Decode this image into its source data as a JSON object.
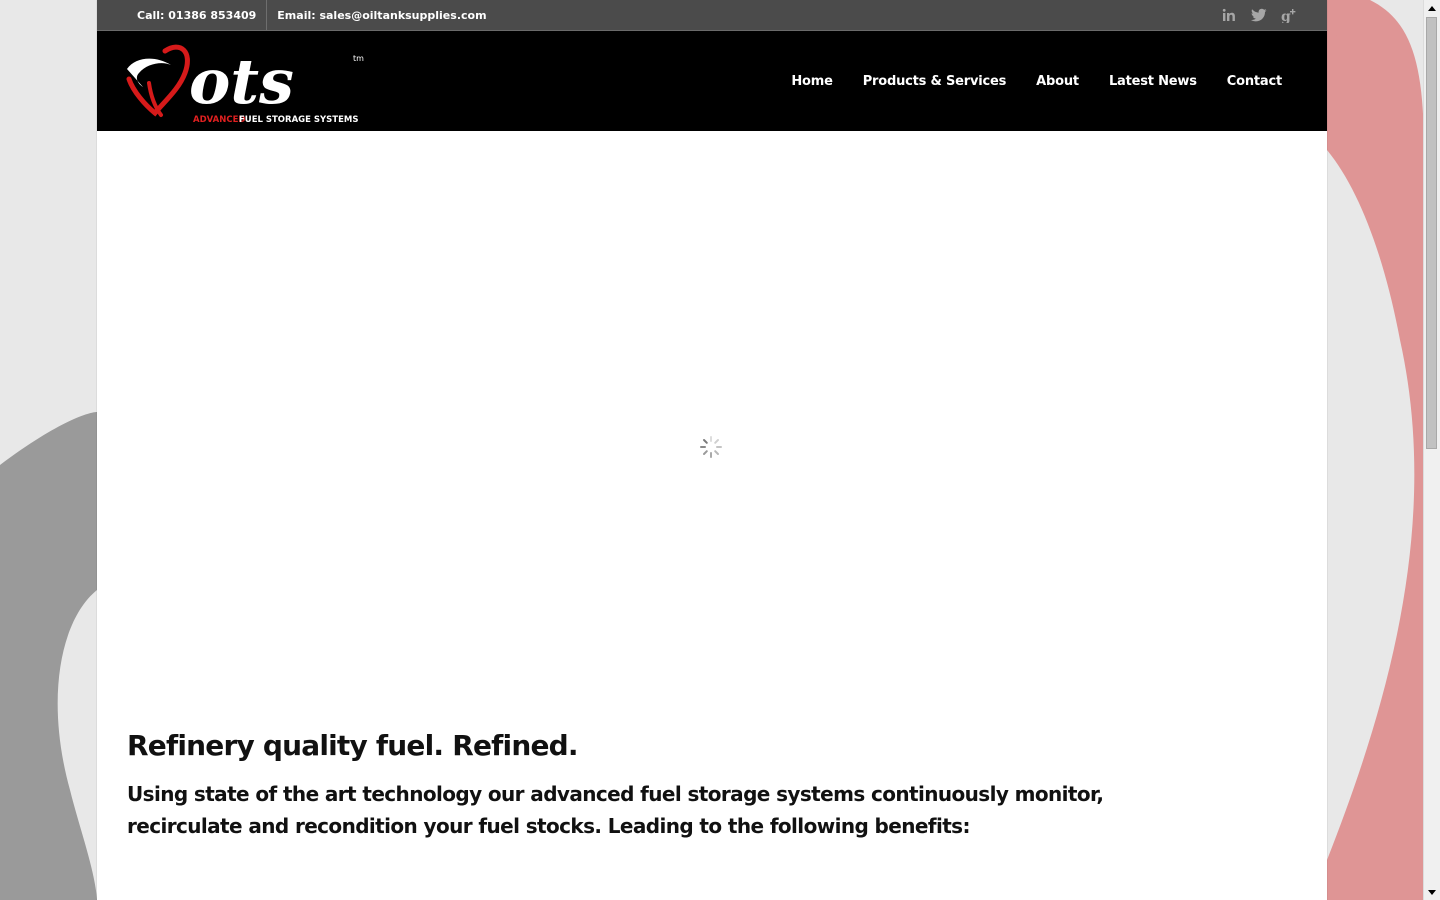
{
  "topbar": {
    "phone": "Call: 01386 853409",
    "email": "Email: sales@oiltanksupplies.com",
    "social": [
      {
        "icon": "linkedin-icon",
        "glyph": "in"
      },
      {
        "icon": "twitter-icon",
        "glyph": "t"
      },
      {
        "icon": "google-plus-icon",
        "glyph": "g+"
      }
    ]
  },
  "logo": {
    "wordmark": "ots",
    "tm": "tm",
    "tagline_accent": "ADVANCED",
    "tagline_rest": "FUEL STORAGE SYSTEMS"
  },
  "nav": {
    "items": [
      "Home",
      "Products & Services",
      "About",
      "Latest News",
      "Contact"
    ]
  },
  "hero": {
    "state": "loading"
  },
  "content": {
    "heading": "Refinery quality fuel. Refined.",
    "intro": "Using state of the art technology our advanced fuel storage systems continuously monitor, recirculate and recondition your fuel stocks. Leading to the following benefits:"
  },
  "colors": {
    "topbar_bg": "#4b4b4b",
    "header_bg": "#000000",
    "brand_red": "#e02020",
    "bg_grey": "#e8e8e8",
    "shape_grey": "#9a9a9a",
    "shape_pink": "#df9595"
  }
}
